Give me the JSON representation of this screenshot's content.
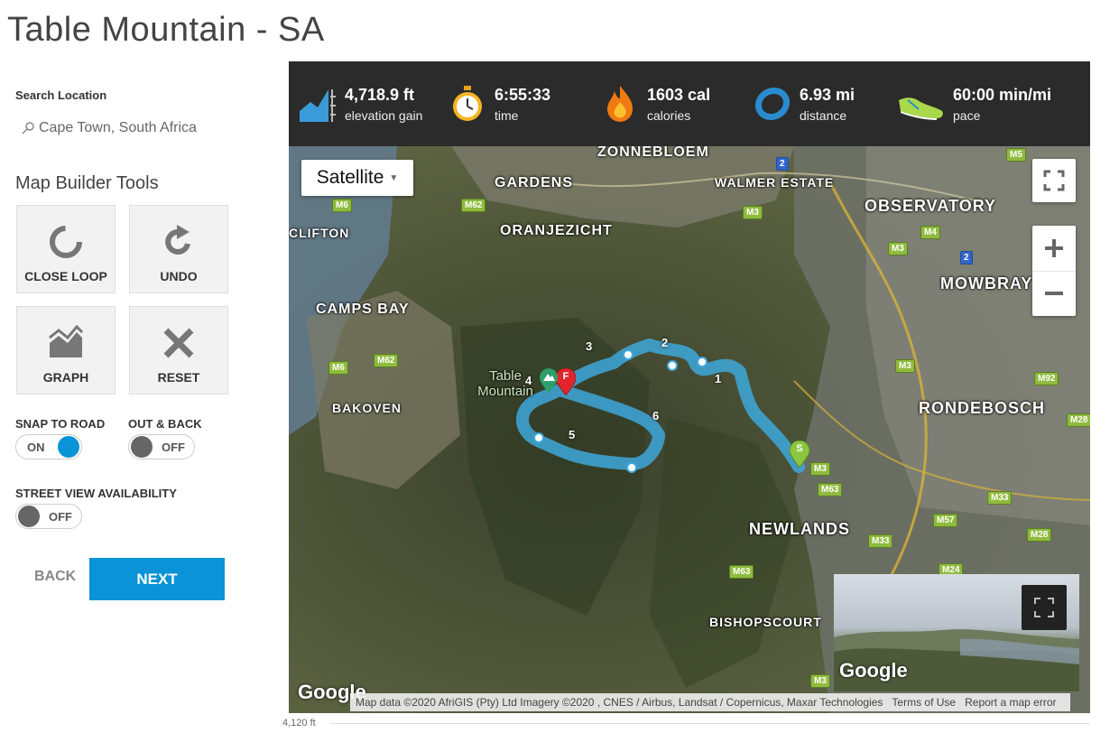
{
  "page": {
    "title": "Table Mountain - SA"
  },
  "sidebar": {
    "search_label": "Search Location",
    "search_value": "Cape Town, South Africa",
    "tools_title": "Map Builder Tools",
    "tools": [
      {
        "label": "CLOSE LOOP",
        "icon": "close-loop-icon"
      },
      {
        "label": "UNDO",
        "icon": "undo-icon"
      },
      {
        "label": "GRAPH",
        "icon": "graph-icon"
      },
      {
        "label": "RESET",
        "icon": "reset-icon"
      }
    ],
    "toggles": {
      "snap": {
        "label": "SNAP TO ROAD",
        "state": "ON"
      },
      "outback": {
        "label": "OUT & BACK",
        "state": "OFF"
      },
      "streetview": {
        "label": "STREET VIEW AVAILABILITY",
        "state": "OFF"
      }
    },
    "back_label": "BACK",
    "next_label": "NEXT"
  },
  "stats": [
    {
      "value": "4,718.9 ft",
      "label": "elevation gain",
      "icon": "elevation-icon"
    },
    {
      "value": "6:55:33",
      "label": "time",
      "icon": "stopwatch-icon"
    },
    {
      "value": "1603 cal",
      "label": "calories",
      "icon": "flame-icon"
    },
    {
      "value": "6.93 mi",
      "label": "distance",
      "icon": "distance-icon"
    },
    {
      "value": "60:00 min/mi",
      "label": "pace",
      "icon": "shoe-icon"
    }
  ],
  "map": {
    "type_selector": "Satellite",
    "places": {
      "zonnebloem": "ZONNEBLOEM",
      "gardens": "GARDENS",
      "walmer": "WALMER ESTATE",
      "observatory": "OBSERVATORY",
      "clifton": "CLIFTON",
      "oranjezicht": "ORANJEZICHT",
      "mowbray": "MOWBRAY",
      "campsbay": "CAMPS BAY",
      "bakoven": "BAKOVEN",
      "rondebosch": "RONDEBOSCH",
      "newlands": "NEWLANDS",
      "bishopscourt": "BISHOPSCOURT",
      "table_mountain": "Table Mountain"
    },
    "roads": [
      "M5",
      "M6",
      "M62",
      "M3",
      "M4",
      "M3",
      "M3",
      "M92",
      "M28",
      "M63",
      "M33",
      "M57",
      "M28",
      "M24",
      "M63",
      "M3",
      "M33",
      "M6",
      "M62",
      "M3",
      "2",
      "2"
    ],
    "waypoints": [
      "1",
      "2",
      "3",
      "4",
      "5",
      "6"
    ],
    "markers": {
      "start": "S",
      "finish": "F"
    },
    "google": "Google",
    "attribution": {
      "data": "Map data ©2020 AfriGIS (Pty) Ltd Imagery ©2020 , CNES / Airbus, Landsat / Copernicus, Maxar Technologies",
      "terms": "Terms of Use",
      "report": "Report a map error"
    }
  },
  "elevation": {
    "axis_label": "4,120 ft"
  },
  "colors": {
    "accent": "#0a93d6",
    "stats_bg": "#2b2b2b",
    "route": "#3da8db"
  }
}
